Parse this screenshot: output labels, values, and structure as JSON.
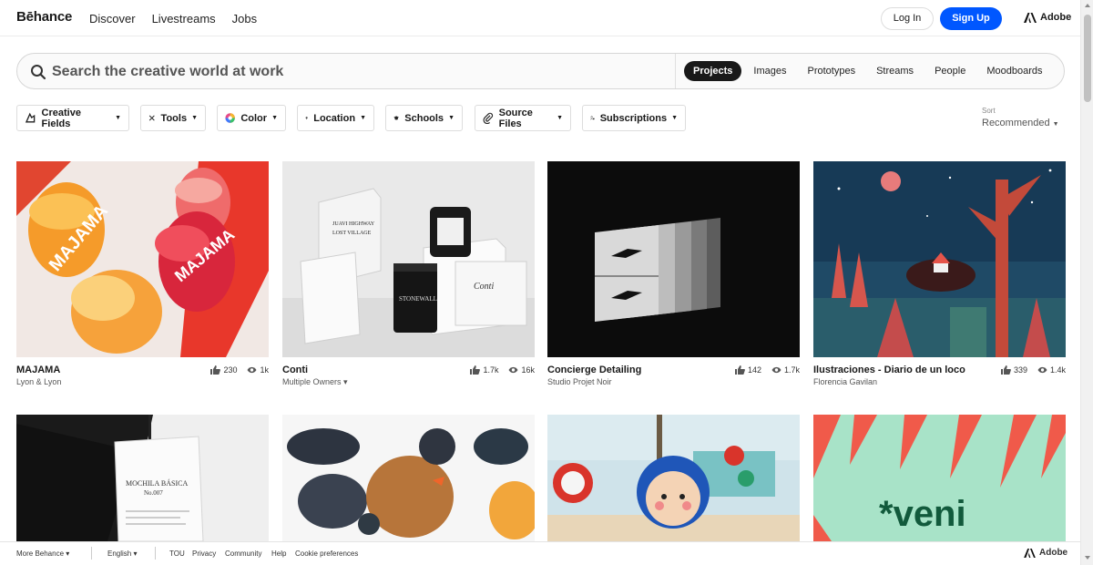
{
  "nav": {
    "logo": "Bēhance",
    "links": [
      "Discover",
      "Livestreams",
      "Jobs"
    ],
    "login": "Log In",
    "signup": "Sign Up",
    "adobe": "Adobe"
  },
  "search": {
    "placeholder": "Search the creative world at work",
    "tabs": [
      "Projects",
      "Images",
      "Prototypes",
      "Streams",
      "People",
      "Moodboards"
    ],
    "active_tab": "Projects"
  },
  "filters": {
    "items": [
      "Creative Fields",
      "Tools",
      "Color",
      "Location",
      "Schools",
      "Source Files",
      "Subscriptions"
    ],
    "sort_label": "Sort",
    "sort_value": "Recommended"
  },
  "projects": [
    {
      "title": "MAJAMA",
      "owner": "Lyon & Lyon",
      "likes": "230",
      "views": "1k"
    },
    {
      "title": "Conti",
      "owner": "Multiple Owners ▾",
      "likes": "1.7k",
      "views": "16k"
    },
    {
      "title": "Concierge Detailing",
      "owner": "Studio Projet Noir",
      "likes": "142",
      "views": "1.7k"
    },
    {
      "title": "Ilustraciones - Diario de un loco",
      "owner": "Florencia Gavilan",
      "likes": "339",
      "views": "1.4k"
    }
  ],
  "thumb_text": {
    "veni": "*veni",
    "mochila": "MOCHILA BÁSICA",
    "mochila_no": "No.007",
    "stonewall": "STONEWALL"
  },
  "footer": {
    "more": "More Behance ▾",
    "lang": "English ▾",
    "links": [
      "TOU",
      "Privacy",
      "Community",
      "Help",
      "Cookie preferences"
    ],
    "adobe": "Adobe"
  },
  "colors": {
    "accent": "#0057ff",
    "active_tab": "#191919"
  }
}
